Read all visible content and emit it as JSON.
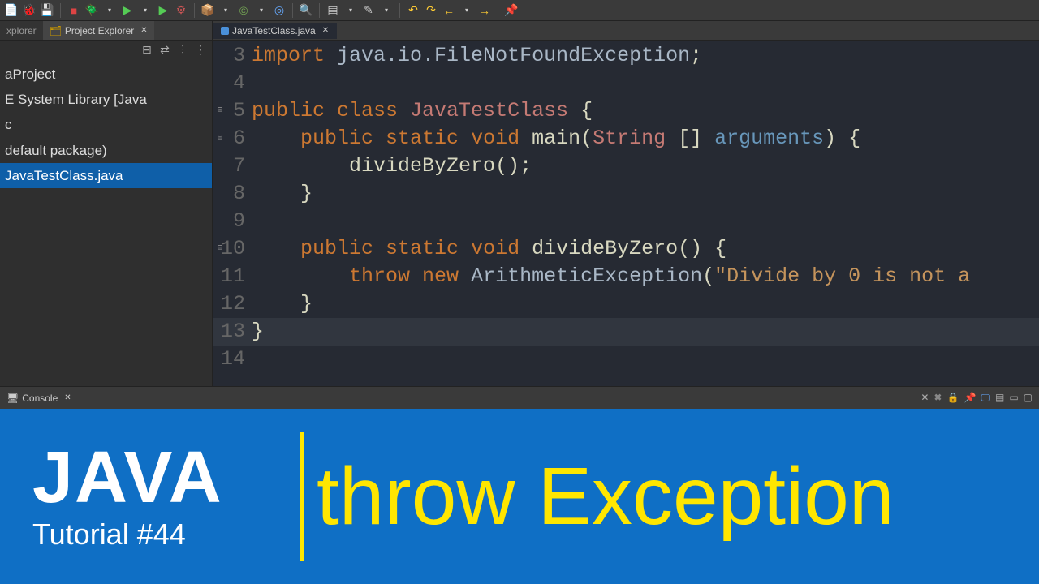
{
  "toolbar": {
    "icons": [
      "new",
      "bug",
      "save",
      "stop",
      "debug-config",
      "run",
      "run-config",
      "ext-tools",
      "build",
      "package",
      "search",
      "tasks",
      "back",
      "fwd",
      "left",
      "right",
      "home",
      "pin",
      "perspective"
    ]
  },
  "sidebar": {
    "tabs": [
      {
        "label": "xplorer",
        "active": false
      },
      {
        "label": "Project Explorer",
        "active": true
      }
    ],
    "tree": [
      {
        "label": "aProject",
        "kind": "project"
      },
      {
        "label": "E System Library [Java",
        "kind": "lib"
      },
      {
        "label": "c",
        "kind": "folder"
      },
      {
        "label": "default package)",
        "kind": "package"
      },
      {
        "label": "JavaTestClass.java",
        "kind": "file",
        "selected": true
      }
    ]
  },
  "editor": {
    "tab": "JavaTestClass.java",
    "lines": [
      {
        "n": 3,
        "tokens": [
          {
            "t": "kw",
            "v": "import "
          },
          {
            "t": "type",
            "v": "java.io.FileNotFoundException"
          },
          {
            "t": "punct",
            "v": ";"
          }
        ],
        "partial": true
      },
      {
        "n": 4,
        "tokens": []
      },
      {
        "n": 5,
        "fold": true,
        "tokens": [
          {
            "t": "kw",
            "v": "public class "
          },
          {
            "t": "class-name",
            "v": "JavaTestClass"
          },
          {
            "t": "punct",
            "v": " {"
          }
        ]
      },
      {
        "n": 6,
        "fold": true,
        "tokens": [
          {
            "t": "",
            "v": "    "
          },
          {
            "t": "kw",
            "v": "public static "
          },
          {
            "t": "kw",
            "v": "void "
          },
          {
            "t": "method",
            "v": "main"
          },
          {
            "t": "punct",
            "v": "("
          },
          {
            "t": "param-type",
            "v": "String"
          },
          {
            "t": "punct",
            "v": " [] "
          },
          {
            "t": "param-name",
            "v": "arguments"
          },
          {
            "t": "punct",
            "v": ") {"
          }
        ]
      },
      {
        "n": 7,
        "tokens": [
          {
            "t": "",
            "v": "        "
          },
          {
            "t": "method",
            "v": "divideByZero"
          },
          {
            "t": "punct",
            "v": "();"
          }
        ]
      },
      {
        "n": 8,
        "tokens": [
          {
            "t": "",
            "v": "    "
          },
          {
            "t": "punct",
            "v": "}"
          }
        ]
      },
      {
        "n": 9,
        "tokens": []
      },
      {
        "n": 10,
        "fold": true,
        "tokens": [
          {
            "t": "",
            "v": "    "
          },
          {
            "t": "kw",
            "v": "public static "
          },
          {
            "t": "kw",
            "v": "void "
          },
          {
            "t": "method",
            "v": "divideByZero"
          },
          {
            "t": "punct",
            "v": "() {"
          }
        ]
      },
      {
        "n": 11,
        "tokens": [
          {
            "t": "",
            "v": "        "
          },
          {
            "t": "kw",
            "v": "throw new "
          },
          {
            "t": "type",
            "v": "ArithmeticException"
          },
          {
            "t": "punct",
            "v": "("
          },
          {
            "t": "str",
            "v": "\"Divide by 0 is not a"
          }
        ]
      },
      {
        "n": 12,
        "tokens": [
          {
            "t": "",
            "v": "    "
          },
          {
            "t": "punct",
            "v": "}"
          }
        ]
      },
      {
        "n": 13,
        "hl": true,
        "tokens": [
          {
            "t": "punct",
            "v": "}"
          }
        ]
      },
      {
        "n": 14,
        "tokens": []
      }
    ]
  },
  "console": {
    "title": "Console"
  },
  "banner": {
    "title": "JAVA",
    "subtitle": "Tutorial #44",
    "right": "throw Exception"
  }
}
